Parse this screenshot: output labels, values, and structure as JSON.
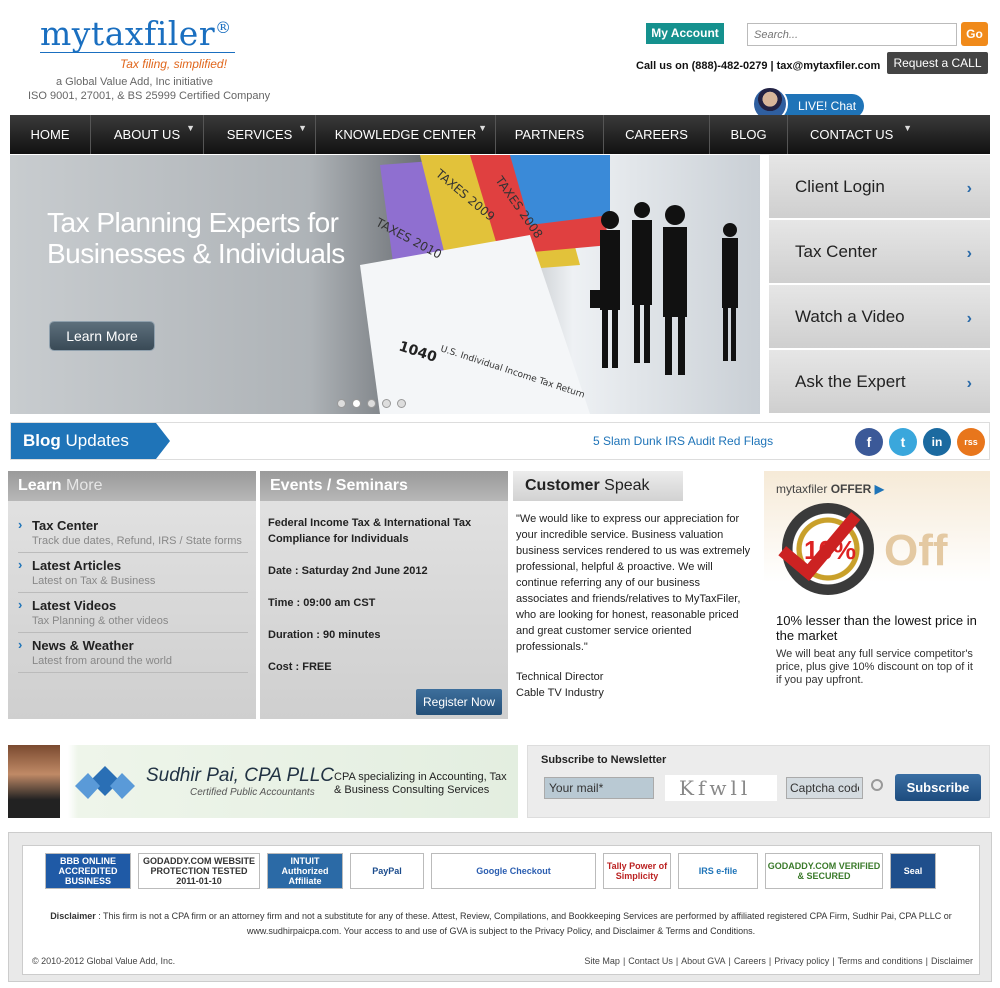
{
  "brand": {
    "name": "mytaxfiler",
    "reg": "®",
    "tagline": "Tax filing, simplified!",
    "initiative": "a Global Value Add, Inc initiative",
    "iso": "ISO 9001, 27001, & BS 25999 Certified Company"
  },
  "header": {
    "my_account": "My Account",
    "search_placeholder": "Search...",
    "go": "Go",
    "call": "Call us on (888)-482-0279  |  tax@mytaxfiler.com",
    "request_call": "Request a CALL",
    "live_chat": "LIVE! Chat"
  },
  "nav": [
    "HOME",
    "ABOUT US",
    "SERVICES",
    "KNOWLEDGE CENTER",
    "PARTNERS",
    "CAREERS",
    "BLOG",
    "CONTACT US"
  ],
  "hero": {
    "line1": "Tax Planning Experts for",
    "line2": "Businesses & Individuals",
    "button": "Learn More",
    "files": [
      "TAXES 2010",
      "TAXES 2009",
      "TAXES 2008"
    ],
    "form": "1040",
    "form_title": "U.S. Individual Income Tax Return"
  },
  "quick_menu": [
    "Client Login",
    "Tax Center",
    "Watch a Video",
    "Ask the Expert"
  ],
  "blog": {
    "tag_bold": "Blog",
    "tag_rest": "Updates",
    "headline": "5 Slam Dunk IRS Audit Red Flags",
    "social": [
      "f",
      "t",
      "in",
      "rss"
    ]
  },
  "learn": {
    "title_bold": "Learn",
    "title_rest": "More",
    "items": [
      {
        "t": "Tax Center",
        "s": "Track due dates, Refund, IRS / State forms"
      },
      {
        "t": "Latest Articles",
        "s": "Latest on Tax & Business"
      },
      {
        "t": "Latest Videos",
        "s": "Tax Planning & other videos"
      },
      {
        "t": "News & Weather",
        "s": "Latest from around the world"
      }
    ]
  },
  "events": {
    "title": "Events / Seminars",
    "name": "Federal Income Tax & International Tax Compliance for Individuals",
    "date": "Date : Saturday 2nd June 2012",
    "time": "Time : 09:00 am CST",
    "duration": "Duration : 90 minutes",
    "cost": "Cost : FREE",
    "register": "Register Now"
  },
  "customer": {
    "title_bold": "Customer",
    "title_rest": "Speak",
    "quote": "\"We would like to express our appreciation for your incredible service. Business valuation business services rendered to us was extremely professional, helpful & proactive. We will continue referring any of our business associates and friends/relatives to MyTaxFiler, who are looking for honest, reasonable priced and great customer service oriented professionals.\"",
    "author": "Technical Director",
    "company": "Cable TV Industry"
  },
  "offer": {
    "brand": "mytaxfiler",
    "label": "OFFER",
    "pct": "10%",
    "off": "Off",
    "headline": "10% lesser than the lowest price in the market",
    "body": "We will beat any full service competitor's price, plus give 10% discount on top of it if you pay upfront."
  },
  "partner": {
    "name": "Sudhir Pai, CPA PLLC",
    "sub": "Certified Public Accountants",
    "desc": "CPA specializing in Accounting, Tax & Business Consulting Services"
  },
  "newsletter": {
    "title": "Subscribe to Newsletter",
    "mail": "Your mail*",
    "captcha": "Kfwll",
    "captcha_placeholder": "Captcha code",
    "button": "Subscribe"
  },
  "footer": {
    "logos": [
      {
        "text": "BBB  ONLINE ACCREDITED BUSINESS",
        "bg": "#1f5aa6",
        "fg": "#fff",
        "w": 86
      },
      {
        "text": "GODADDY.COM WEBSITE PROTECTION TESTED 2011-01-10",
        "bg": "#fff",
        "fg": "#333",
        "w": 122
      },
      {
        "text": "INTUIT Authorized Affiliate",
        "bg": "#2b6aa6",
        "fg": "#fff",
        "w": 76
      },
      {
        "text": "PayPal",
        "bg": "#fff",
        "fg": "#1a4b8c",
        "w": 74
      },
      {
        "text": "Google Checkout",
        "bg": "#fff",
        "fg": "#2a5db0",
        "w": 165
      },
      {
        "text": "Tally Power of Simplicity",
        "bg": "#fff",
        "fg": "#b22",
        "w": 68
      },
      {
        "text": "IRS e-file",
        "bg": "#fff",
        "fg": "#1f74b8",
        "w": 80
      },
      {
        "text": "GODADDY.COM VERIFIED & SECURED",
        "bg": "#fff",
        "fg": "#3a7a2a",
        "w": 118
      },
      {
        "text": "Seal",
        "bg": "#1f4f8c",
        "fg": "#fff",
        "w": 46
      }
    ],
    "disclaimer_label": "Disclaimer",
    "disclaimer": " : This firm is not a CPA firm or an attorney firm and not a substitute for any of these. Attest, Review, Compilations, and Bookkeeping Services are performed by affiliated registered CPA Firm, Sudhir Pai, CPA PLLC or www.sudhirpaicpa.com. Your access to and use of GVA is subject to the Privacy Policy, and Disclaimer & Terms and Conditions.",
    "copyright": "© 2010-2012 Global Value Add, Inc.",
    "links": [
      "Site Map",
      "Contact Us",
      "About GVA",
      "Careers",
      "Privacy policy",
      "Terms and conditions",
      "Disclaimer"
    ]
  }
}
